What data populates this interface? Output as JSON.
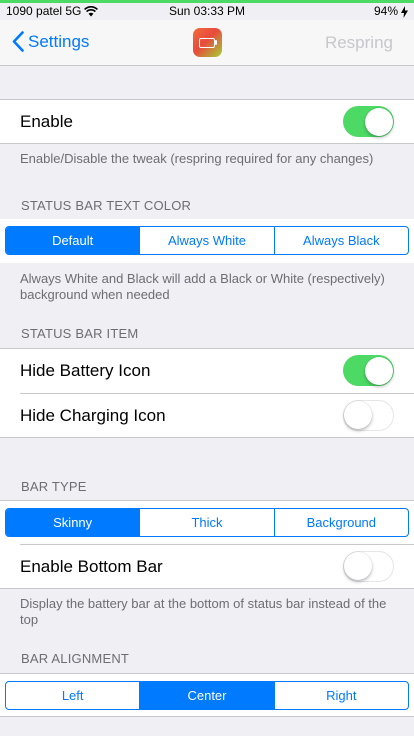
{
  "status_bar": {
    "carrier": "1090 patel 5G",
    "time": "Sun 03:33 PM",
    "battery_percent": "94%",
    "wifi_icon": "wifi-icon",
    "charging_icon": "bolt-icon"
  },
  "nav": {
    "back_label": "Settings",
    "action_label": "Respring",
    "app_icon": "battery-app-icon"
  },
  "enable": {
    "label": "Enable",
    "on": true,
    "footer": "Enable/Disable the tweak (respring required for any changes)"
  },
  "text_color": {
    "header": "STATUS BAR TEXT COLOR",
    "options": [
      "Default",
      "Always White",
      "Always Black"
    ],
    "selected": "Default",
    "footer": "Always White and Black will add a Black or White (respectively) background when needed"
  },
  "item": {
    "header": "STATUS BAR ITEM",
    "rows": [
      {
        "label": "Hide Battery Icon",
        "on": true
      },
      {
        "label": "Hide Charging Icon",
        "on": false
      }
    ]
  },
  "bar_type": {
    "header": "BAR TYPE",
    "options": [
      "Skinny",
      "Thick",
      "Background"
    ],
    "selected": "Skinny",
    "bottom_bar_label": "Enable Bottom Bar",
    "bottom_bar_on": false,
    "footer": "Display the battery bar at the bottom of status bar instead of the top"
  },
  "alignment": {
    "header": "BAR ALIGNMENT",
    "options": [
      "Left",
      "Center",
      "Right"
    ],
    "selected": "Center"
  },
  "colors": {
    "accent": "#007aff",
    "toggle_on": "#4cd964",
    "background": "#efeff4"
  }
}
